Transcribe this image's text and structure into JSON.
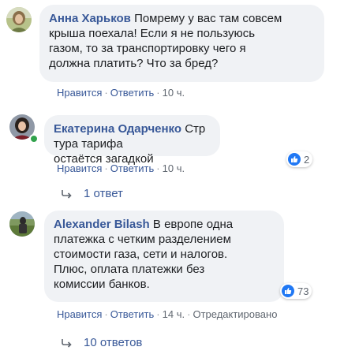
{
  "colors": {
    "link": "#385898",
    "bubble": "#f0f2f5",
    "meta": "#606770",
    "like": "#2078f4",
    "online": "#31a24c"
  },
  "icons": {
    "reply_arrow": "reply-arrow-icon",
    "like": "thumbs-up-icon"
  },
  "comments": [
    {
      "author": "Анна Харьков",
      "text_lines": [
        "Помрему у вас там совсем",
        "крыша поехала! Если я не пользуюсь",
        "газом, то за транспортировку чего я",
        "должна платить? Что за бред?"
      ],
      "like_label": "Нравится",
      "reply_label": "Ответить",
      "time": "10 ч."
    },
    {
      "author": "Екатерина Одарченко",
      "text_lines": [
        "Стр тура тарифа",
        "остаётся загадкой"
      ],
      "like_label": "Нравится",
      "reply_label": "Ответить",
      "time": "10 ч.",
      "reactions": "2",
      "replies": "1 ответ"
    },
    {
      "author": "Alexander Bilash",
      "text_lines": [
        "В европе одна",
        "платежка с четким разделением",
        "стоимости газа, сети и налогов.",
        "Плюс, оплата платежки без",
        "комиссии банков."
      ],
      "like_label": "Нравится",
      "reply_label": "Ответить",
      "time": "14 ч.",
      "edited": "Отредактировано",
      "reactions": "73",
      "replies": "10 ответов"
    }
  ]
}
